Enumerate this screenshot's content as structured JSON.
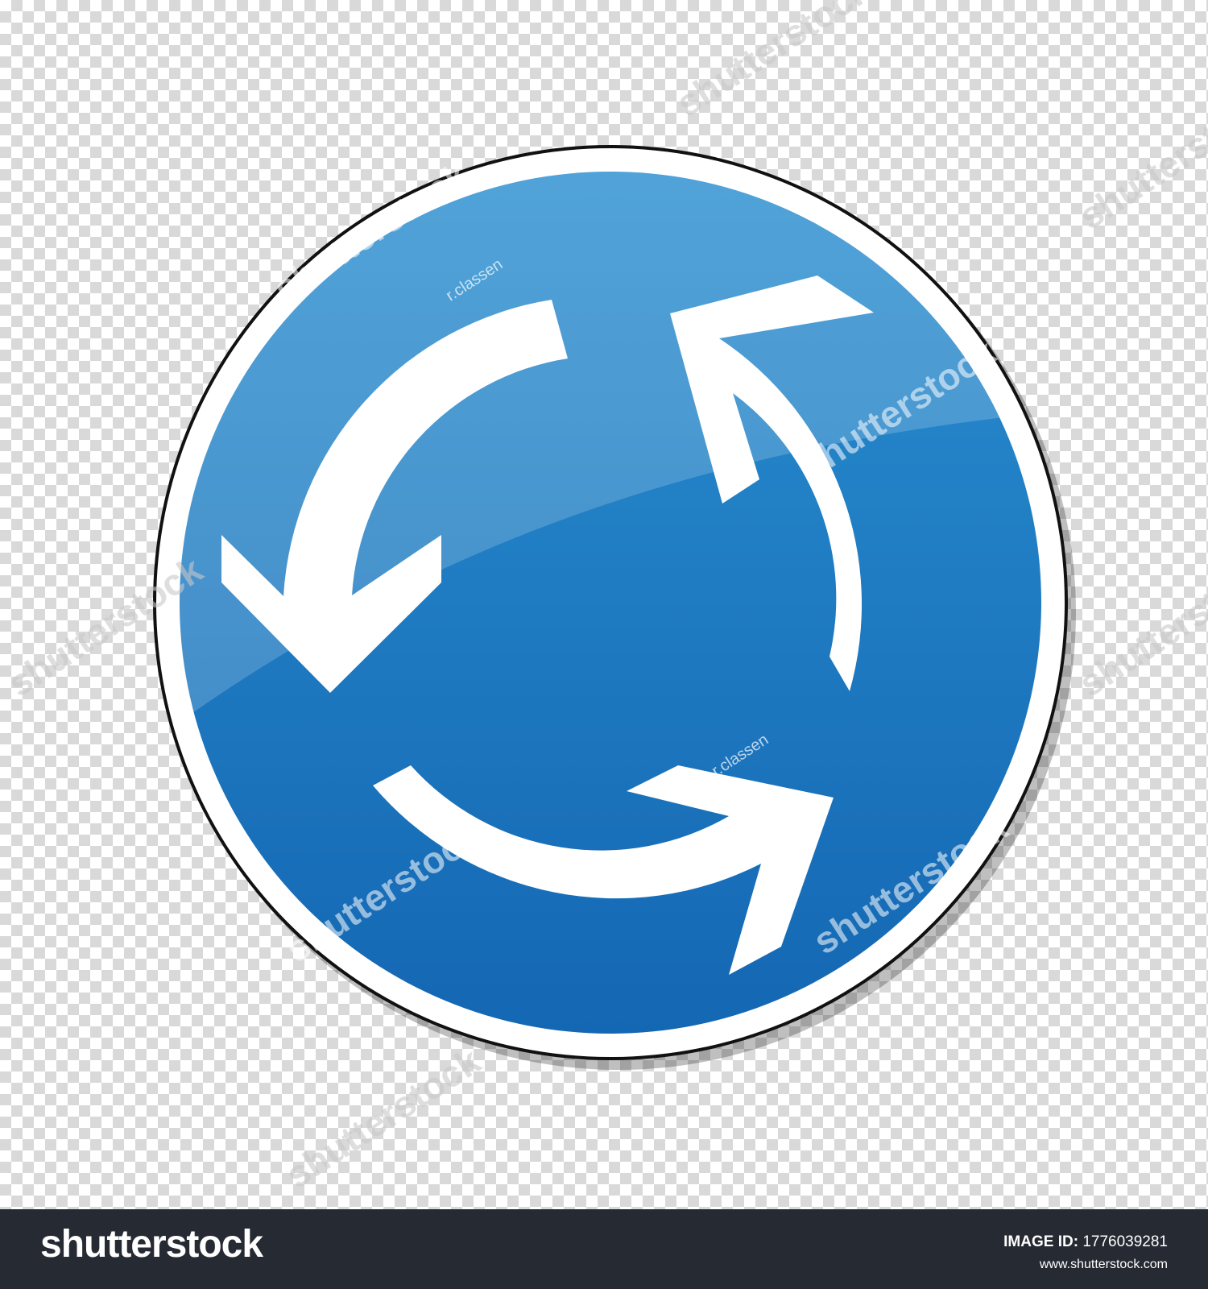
{
  "image": {
    "sign_color": "#1a7cc7",
    "arrow_color": "#ffffff",
    "checker_light": "#ffffff",
    "checker_dark": "#d9d9d9"
  },
  "watermark": {
    "text": "shutterstock",
    "author": "r.classen"
  },
  "footer": {
    "logo": "shutterstock",
    "image_id_label": "IMAGE ID:",
    "image_id": "1776039281",
    "site": "www.shutterstock.com",
    "background": "#262a33"
  }
}
